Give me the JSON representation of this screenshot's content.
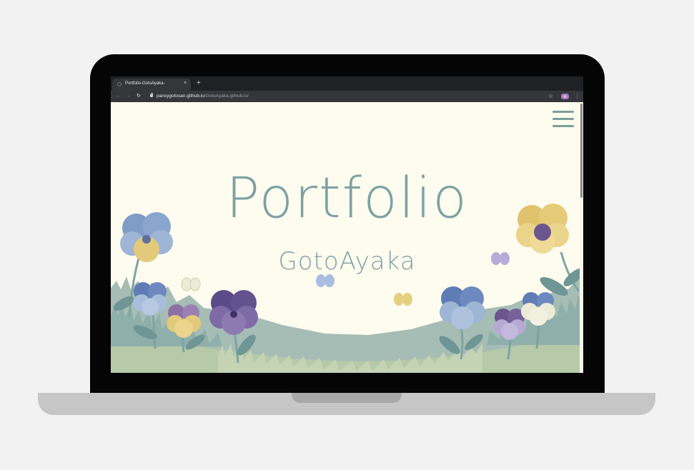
{
  "browser": {
    "tab_title": "Portfolio-GotoAyaka-",
    "tab_close": "×",
    "new_tab": "+",
    "url_host": "pansygotosan.github.io",
    "url_path": "/GotoAyaka.github.io/",
    "icons": [
      "back-icon",
      "forward-icon",
      "reload-icon",
      "lock-icon",
      "star-icon",
      "extension-icon",
      "menu-icon"
    ]
  },
  "page": {
    "title": "Portfolio",
    "subtitle": "GotoAyaka",
    "menu_icon": "hamburger-menu-icon"
  },
  "colors": {
    "page_background": "#fdfcee",
    "accent": "#7da1a3",
    "laptop_body": "#050505"
  }
}
